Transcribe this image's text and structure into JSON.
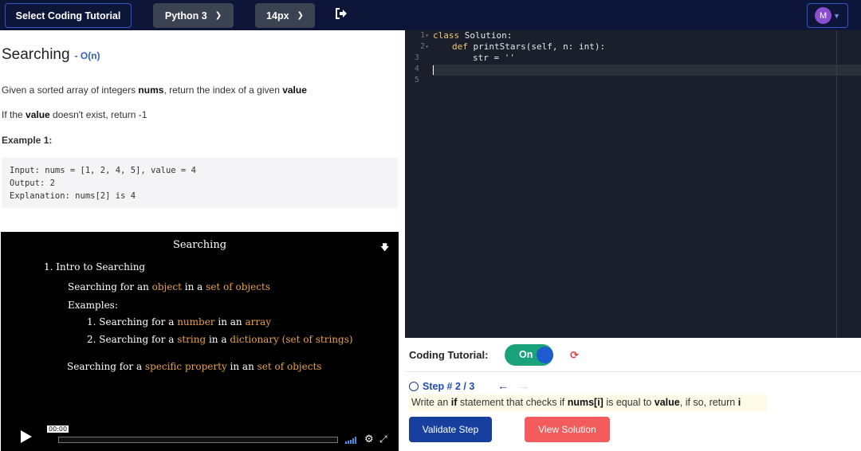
{
  "topbar": {
    "tutorial_button": "Select Coding Tutorial",
    "language": "Python 3",
    "font_size": "14px",
    "avatar_initial": "M"
  },
  "problem": {
    "title": "Searching",
    "complexity": "- O(n)",
    "desc1_pre": "Given a sorted array of integers ",
    "desc1_b1": "nums",
    "desc1_mid": ", return the index of a given ",
    "desc1_b2": "value",
    "desc2_pre": "If the ",
    "desc2_b": "value",
    "desc2_post": " doesn't exist, return -1",
    "example_heading": "Example 1:",
    "example_lines": [
      "Input: nums = [1, 2, 4, 5], value = 4",
      "Output: 2",
      "Explanation: nums[2] is 4"
    ]
  },
  "video": {
    "slide_title": "Searching",
    "l1": "1. Intro to Searching",
    "l2_a": "Searching for an ",
    "l2_b": "object",
    "l2_c": " in a ",
    "l2_d": "set of objects",
    "l3": "Examples:",
    "l4_a": "1. Searching for a ",
    "l4_b": "number",
    "l4_c": " in an ",
    "l4_d": "array",
    "l5_a": "2. Searching for a ",
    "l5_b": "string",
    "l5_c": " in a ",
    "l5_d": "dictionary (set of strings)",
    "l6_a": "Searching for a ",
    "l6_b": "specific property",
    "l6_c": " in an ",
    "l6_d": "set of objects",
    "time": "00:00"
  },
  "editor": {
    "line_numbers": [
      "1",
      "2",
      "3",
      "4",
      "5"
    ],
    "line1_kw": "class",
    "line1_rest": " Solution:",
    "line2_kw": "def",
    "line2_rest": " printStars(self, n: int):",
    "line3_var": "str = ",
    "line3_str": "''"
  },
  "tutorial": {
    "label": "Coding Tutorial:",
    "toggle_text": "On",
    "step_label": "Step # 2 / 3",
    "instr_a": "Write an ",
    "instr_b": "if",
    "instr_c": " statement that checks if ",
    "instr_d": "nums[i]",
    "instr_e": " is equal to ",
    "instr_f": "value",
    "instr_g": ", if so, return ",
    "instr_h": "i",
    "validate_button": "Validate Step",
    "solution_button": "View Solution"
  },
  "colors": {
    "topbar_bg": "#0d1638",
    "editor_bg": "#1a1f2b",
    "toggle_on": "#1aa27a",
    "validate": "#173f9e",
    "solution": "#f25c5c",
    "slide_accent": "#e8a047"
  }
}
